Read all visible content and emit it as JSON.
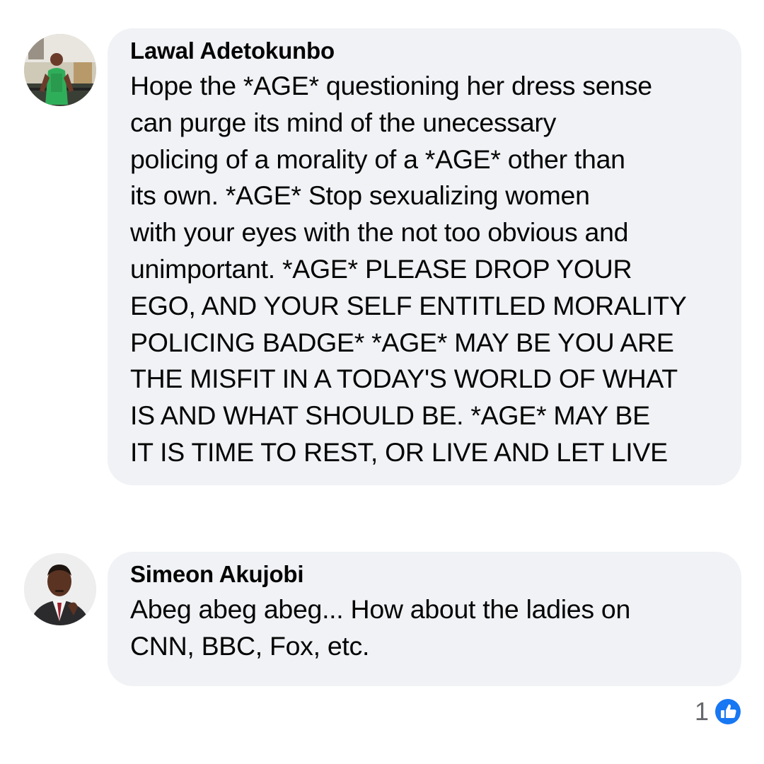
{
  "comments": [
    {
      "author": "Lawal Adetokunbo",
      "text": "Hope the *AGE* questioning her dress sense\ncan purge its mind of the unecessary\npolicing of a morality of a *AGE* other than\nits own.  *AGE* Stop sexualizing women\nwith your eyes with the not too obvious and\nunimportant.  *AGE* PLEASE DROP YOUR\nEGO, AND YOUR SELF ENTITLED MORALITY\nPOLICING BADGE*  *AGE* MAY BE YOU ARE\nTHE MISFIT IN A TODAY'S WORLD OF WHAT\nIS AND WHAT SHOULD BE.  *AGE* MAY BE\nIT IS TIME TO REST, OR LIVE AND LET LIVE"
    },
    {
      "author": "Simeon Akujobi",
      "text": "Abeg abeg abeg... How about the ladies on\nCNN, BBC, Fox, etc."
    }
  ],
  "reactions": {
    "count": "1",
    "icon": "like-icon",
    "color": "#1877f2"
  },
  "colors": {
    "bubble": "#f0f2f5",
    "text": "#050505",
    "meta": "#65676b"
  }
}
